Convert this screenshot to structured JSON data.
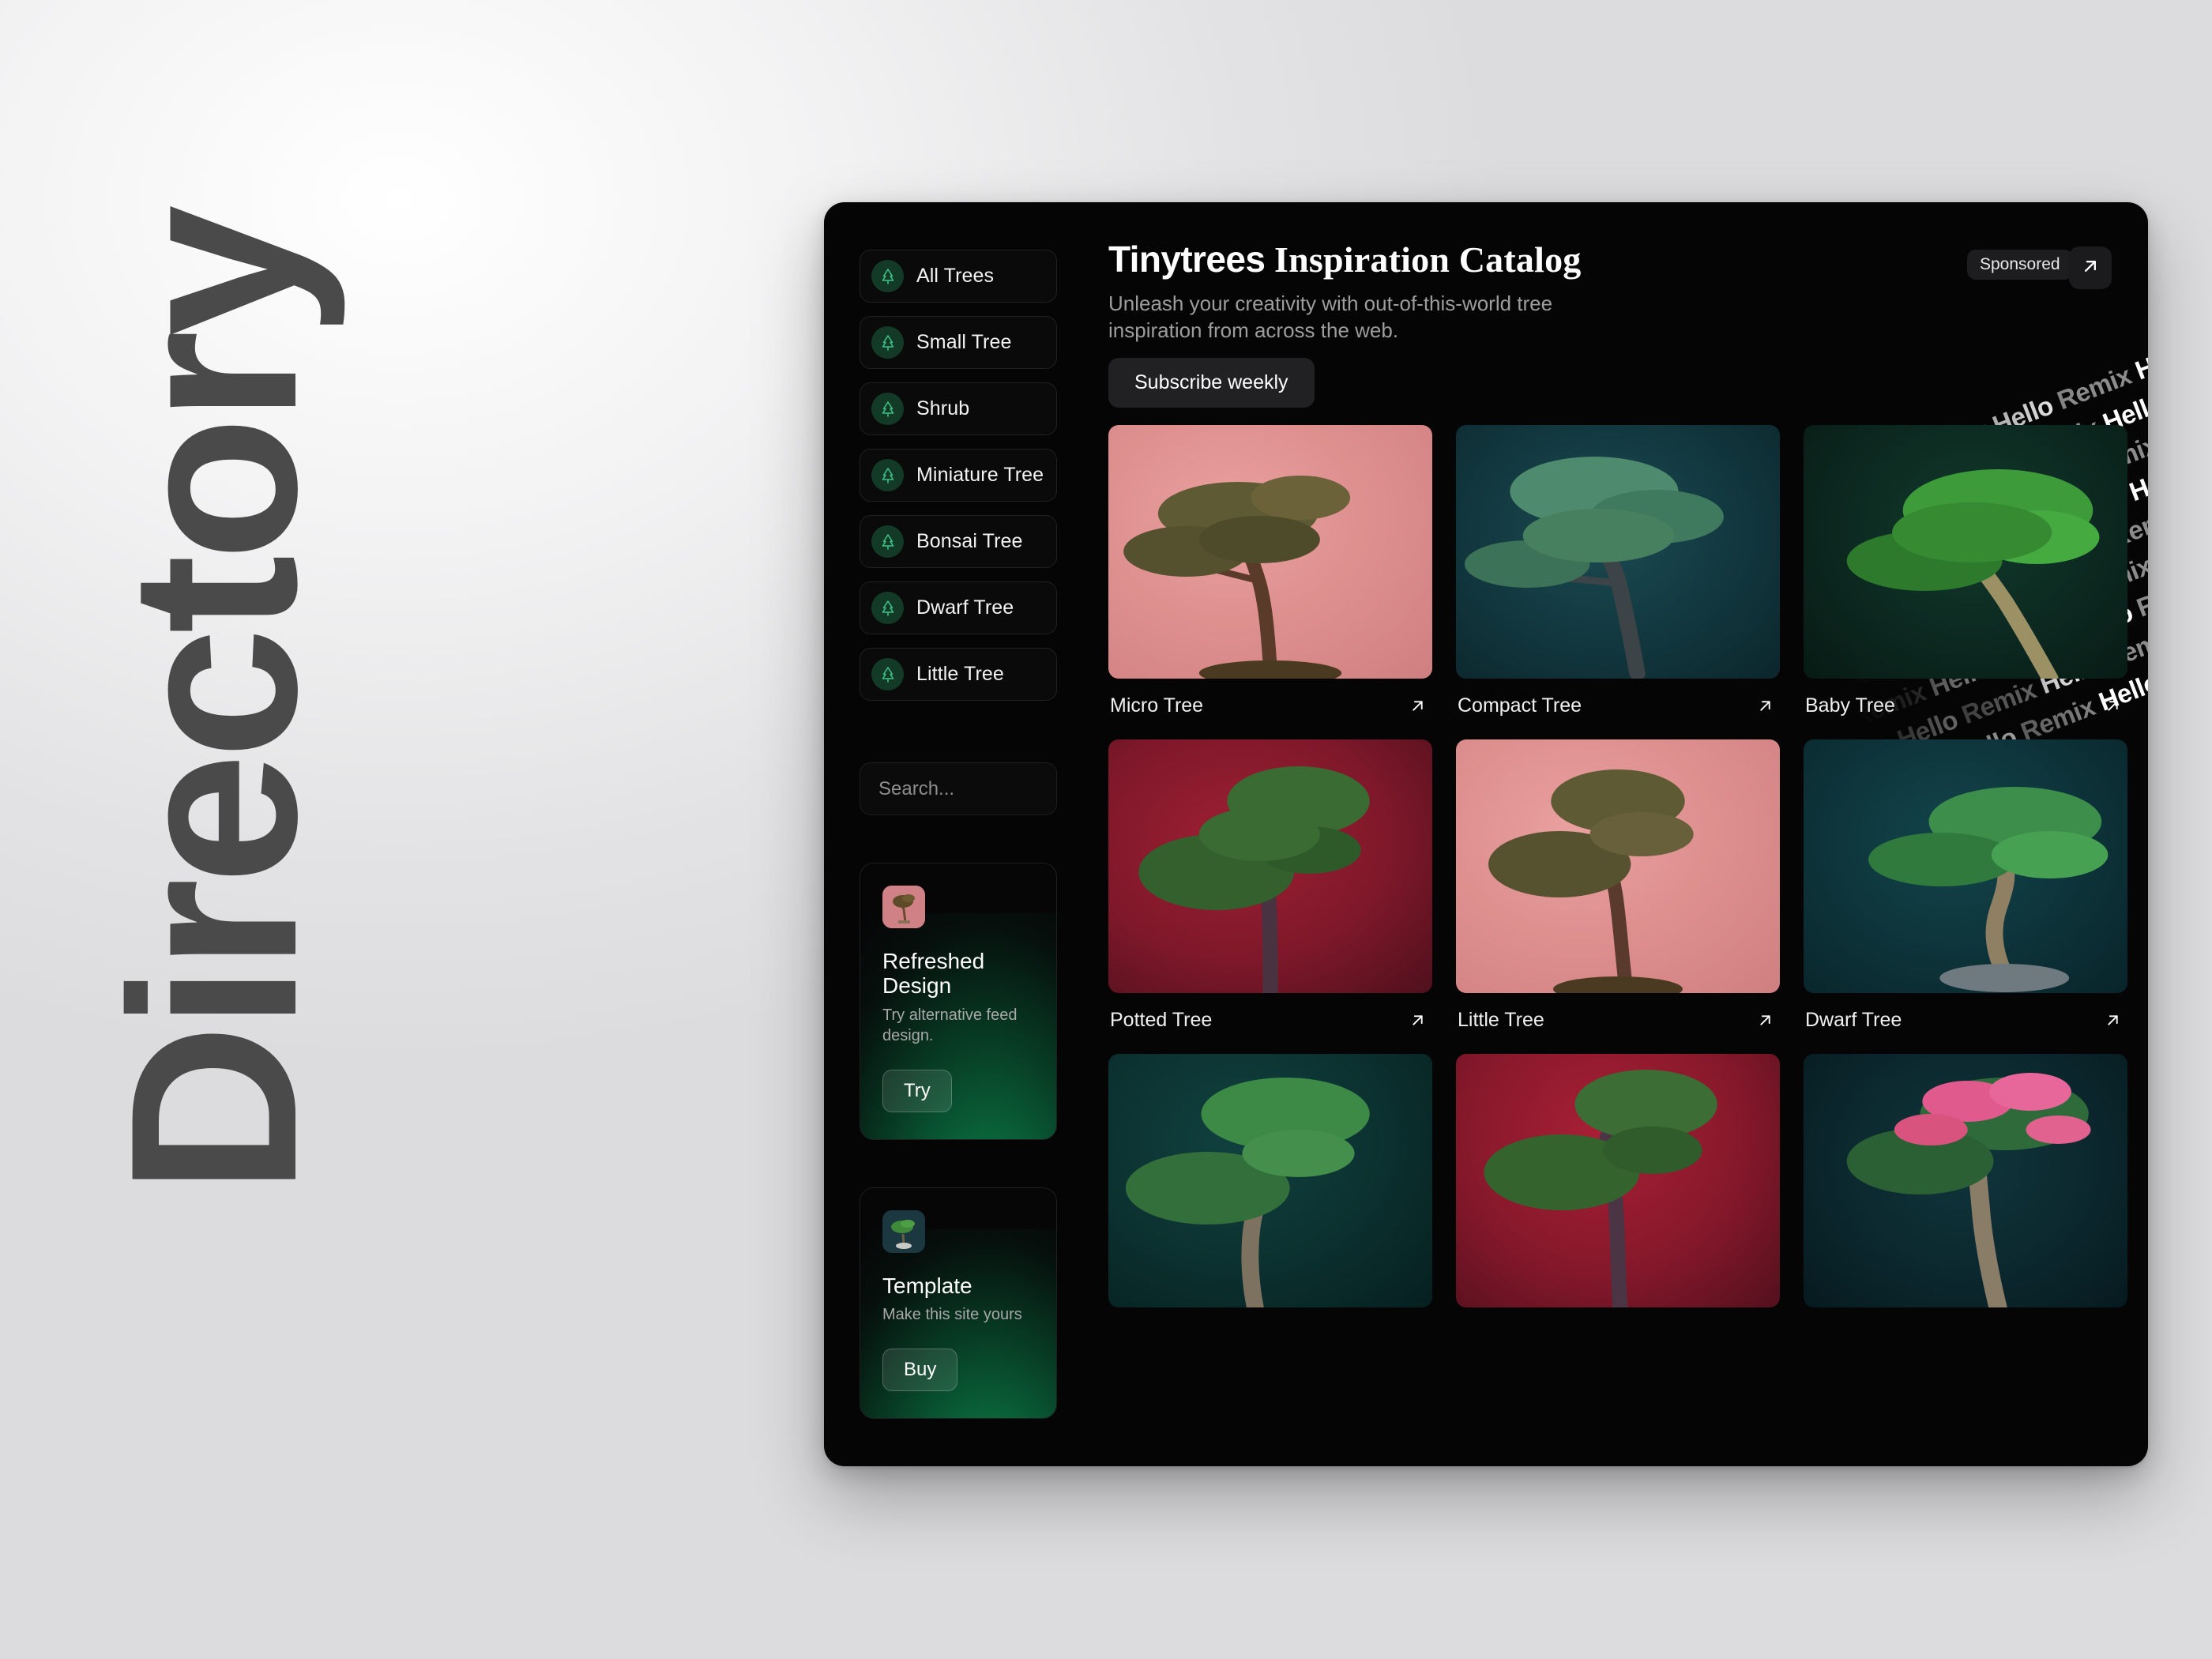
{
  "wordmark": "Directory",
  "sidebar": {
    "nav_items": [
      {
        "label": "All Trees",
        "icon": "tree-icon"
      },
      {
        "label": "Small Tree",
        "icon": "tree-icon"
      },
      {
        "label": "Shrub",
        "icon": "tree-icon"
      },
      {
        "label": "Miniature Tree",
        "icon": "tree-icon"
      },
      {
        "label": "Bonsai Tree",
        "icon": "tree-icon"
      },
      {
        "label": "Dwarf Tree",
        "icon": "tree-icon"
      },
      {
        "label": "Little Tree",
        "icon": "tree-icon"
      }
    ],
    "search": {
      "value": "",
      "placeholder": "Search...",
      "icon": "search-icon"
    },
    "promos": [
      {
        "title": "Refreshed Design",
        "subtitle": "Try alternative feed design.",
        "button": "Try",
        "thumb": "pink-bonsai-thumb"
      },
      {
        "title": "Template",
        "subtitle": "Make this site yours",
        "button": "Buy",
        "thumb": "teal-bonsai-thumb"
      }
    ]
  },
  "header": {
    "title_brand": "Tinytrees",
    "title_rest": " Inspiration Catalog",
    "subtitle": "Unleash your creativity with out-of-this-world tree inspiration from across the web.",
    "sponsored_badge": "Sponsored",
    "subscribe_button": "Subscribe weekly",
    "open_external_icon": "arrow-up-right-icon",
    "pattern_words": {
      "hello": "Hello",
      "remix": "Remix"
    }
  },
  "grid": {
    "link_icon": "arrow-up-right-icon",
    "cards": [
      {
        "name": "Micro Tree",
        "bg": "bg-salmon",
        "accent": "#de908f"
      },
      {
        "name": "Compact Tree",
        "bg": "bg-teal",
        "accent": "#12383f"
      },
      {
        "name": "Baby Tree",
        "bg": "bg-darkgreen",
        "accent": "#0c2a21"
      },
      {
        "name": "Potted Tree",
        "bg": "bg-crimson",
        "accent": "#7e182a"
      },
      {
        "name": "Little Tree",
        "bg": "bg-salmon",
        "accent": "#de908f"
      },
      {
        "name": "Dwarf Tree",
        "bg": "bg-deepteal",
        "accent": "#0d343a"
      },
      {
        "name": "",
        "bg": "bg-tealdark",
        "accent": "#0b302f"
      },
      {
        "name": "",
        "bg": "bg-crimson2",
        "accent": "#86182b"
      },
      {
        "name": "",
        "bg": "bg-teal3",
        "accent": "#0b282e"
      }
    ]
  },
  "colors": {
    "window_bg": "#050506",
    "accent_green": "#0b7a45",
    "icon_green": "#3fbf85",
    "icon_circle": "#123a26",
    "text_primary": "#ffffff",
    "text_muted": "#9d9d9d"
  }
}
